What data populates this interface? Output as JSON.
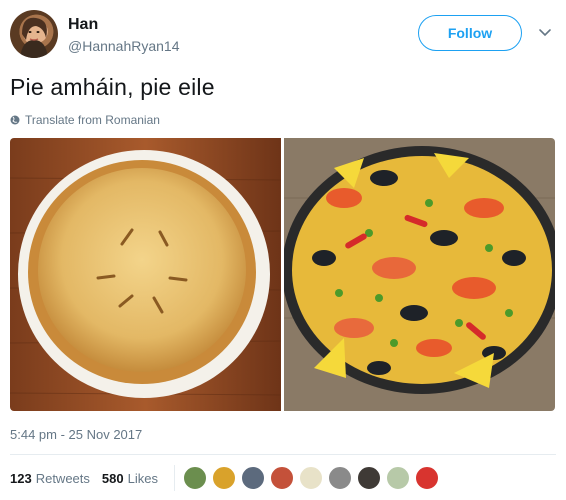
{
  "user": {
    "name": "Han",
    "handle": "@HannahRyan14"
  },
  "follow_button": "Follow",
  "tweet": {
    "text": "Pie amháin, pie eile",
    "translate_label": "Translate from Romanian",
    "timestamp": "5:44 pm - 25 Nov 2017"
  },
  "stats": {
    "retweets_count": "123",
    "retweets_label": "Retweets",
    "likes_count": "580",
    "likes_label": "Likes"
  },
  "likers": [
    {
      "color": "#6b8e4e"
    },
    {
      "color": "#d9a22b"
    },
    {
      "color": "#5c6a7d"
    },
    {
      "color": "#c4513a"
    },
    {
      "color": "#e8e2c8"
    },
    {
      "color": "#8a8a8a"
    },
    {
      "color": "#3f3a36"
    },
    {
      "color": "#b7c9a8"
    },
    {
      "color": "#d8342f"
    }
  ],
  "colors": {
    "accent": "#1da1f2",
    "secondary_text": "#657786"
  }
}
